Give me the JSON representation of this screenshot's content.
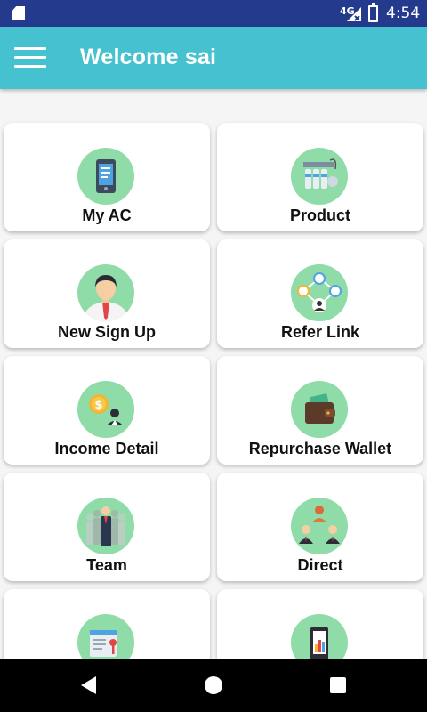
{
  "status_bar": {
    "network": "4G",
    "time": "4:54",
    "icons": [
      "sim-card-icon",
      "signal-icon",
      "battery-icon"
    ]
  },
  "app_bar": {
    "title": "Welcome sai",
    "menu_icon": "hamburger-menu-icon",
    "background_color": "#45c1cf"
  },
  "menu": {
    "items": [
      {
        "label": "My AC",
        "icon": "mobile-phone-icon"
      },
      {
        "label": "Product",
        "icon": "water-purifier-icon"
      },
      {
        "label": "New Sign Up",
        "icon": "businessman-avatar-icon"
      },
      {
        "label": "Refer Link",
        "icon": "share-network-icon"
      },
      {
        "label": "Income Detail",
        "icon": "dollar-coin-person-icon"
      },
      {
        "label": "Repurchase Wallet",
        "icon": "wallet-icon"
      },
      {
        "label": "Team",
        "icon": "team-people-icon"
      },
      {
        "label": "Direct",
        "icon": "hierarchy-people-icon"
      },
      {
        "label": "",
        "icon": "document-key-icon"
      },
      {
        "label": "",
        "icon": "mobile-chart-icon"
      }
    ],
    "icon_circle_color": "#8fdca8"
  },
  "nav_bar": {
    "icons": [
      "back-triangle-icon",
      "home-circle-icon",
      "recents-square-icon"
    ]
  }
}
